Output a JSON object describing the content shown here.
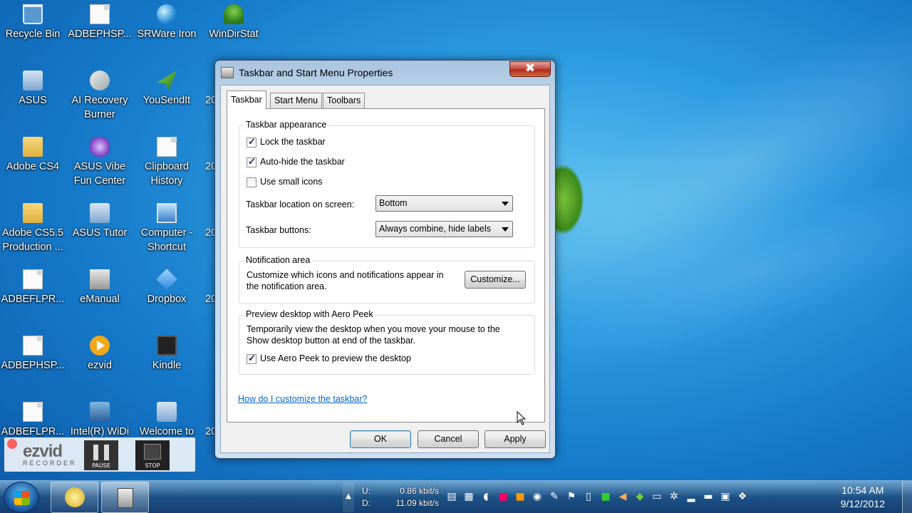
{
  "desktop": {
    "icons": [
      {
        "label": "Recycle Bin",
        "icon": "recycle-bin-icon"
      },
      {
        "label": "ADBEPHSP...",
        "icon": "document-icon"
      },
      {
        "label": "SRWare Iron",
        "icon": "browser-icon"
      },
      {
        "label": "WinDirStat",
        "icon": "tree-icon"
      },
      {
        "label": "ASUS",
        "icon": "asus-icon"
      },
      {
        "label": "AI Recovery\nBurner",
        "icon": "recovery-icon"
      },
      {
        "label": "YouSendIt",
        "icon": "paper-plane-icon"
      },
      {
        "label": "Adobe CS4",
        "icon": "folder-icon"
      },
      {
        "label": "ASUS  Vibe\nFun Center",
        "icon": "vibe-icon"
      },
      {
        "label": "Clipboard\nHistory",
        "icon": "clipboard-icon"
      },
      {
        "label": "Adobe CS5.5\nProduction ...",
        "icon": "folder-icon"
      },
      {
        "label": "ASUS Tutor",
        "icon": "tutor-icon"
      },
      {
        "label": "Computer -\nShortcut",
        "icon": "computer-icon"
      },
      {
        "label": "ADBEFLPR...",
        "icon": "document-icon"
      },
      {
        "label": "eManual",
        "icon": "manual-icon"
      },
      {
        "label": "Dropbox",
        "icon": "dropbox-icon"
      },
      {
        "label": "ADBEPHSP...",
        "icon": "document-icon"
      },
      {
        "label": "ezvid",
        "icon": "ezvid-icon"
      },
      {
        "label": "Kindle",
        "icon": "kindle-icon"
      },
      {
        "label": "ADBEFLPR...",
        "icon": "adobe-icon"
      },
      {
        "label": "Intel(R) WiDi",
        "icon": "widi-icon"
      },
      {
        "label": "Welcome to",
        "icon": "asus-welcome-icon"
      }
    ],
    "partial_labels": [
      "20",
      "20",
      "20",
      "20",
      "20"
    ]
  },
  "ezvid": {
    "logo": "ezvid",
    "tagline": "RECORDER",
    "pause_label": "PAUSE",
    "stop_label": "STOP"
  },
  "dialog": {
    "title": "Taskbar and Start Menu Properties",
    "close_symbol": "✖",
    "tabs": [
      "Taskbar",
      "Start Menu",
      "Toolbars"
    ],
    "appearance": {
      "heading": "Taskbar appearance",
      "lock_label": "Lock the taskbar",
      "lock_checked": true,
      "autohide_label": "Auto-hide the taskbar",
      "autohide_checked": true,
      "small_icons_label": "Use small icons",
      "small_icons_checked": false,
      "location_label": "Taskbar location on screen:",
      "location_value": "Bottom",
      "buttons_label": "Taskbar buttons:",
      "buttons_value": "Always combine, hide labels"
    },
    "notification": {
      "heading": "Notification area",
      "description": "Customize which icons and notifications appear in\nthe notification area.",
      "customize_label": "Customize..."
    },
    "aero_peek": {
      "heading": "Preview desktop with Aero Peek",
      "description": "Temporarily view the desktop when you move your mouse to the\nShow desktop button at end of the taskbar.",
      "checkbox_label": "Use Aero Peek to preview the desktop",
      "checked": true
    },
    "help_link": "How do I customize the taskbar?",
    "buttons": {
      "ok": "OK",
      "cancel": "Cancel",
      "apply": "Apply"
    }
  },
  "taskbar": {
    "network": {
      "up_label": "U:",
      "up_value": "0.86 kbit/s",
      "down_label": "D:",
      "down_value": "11.09 kbit/s"
    },
    "clock": {
      "time": "10:54 AM",
      "date": "9/12/2012"
    },
    "tray_expand": "▲"
  }
}
